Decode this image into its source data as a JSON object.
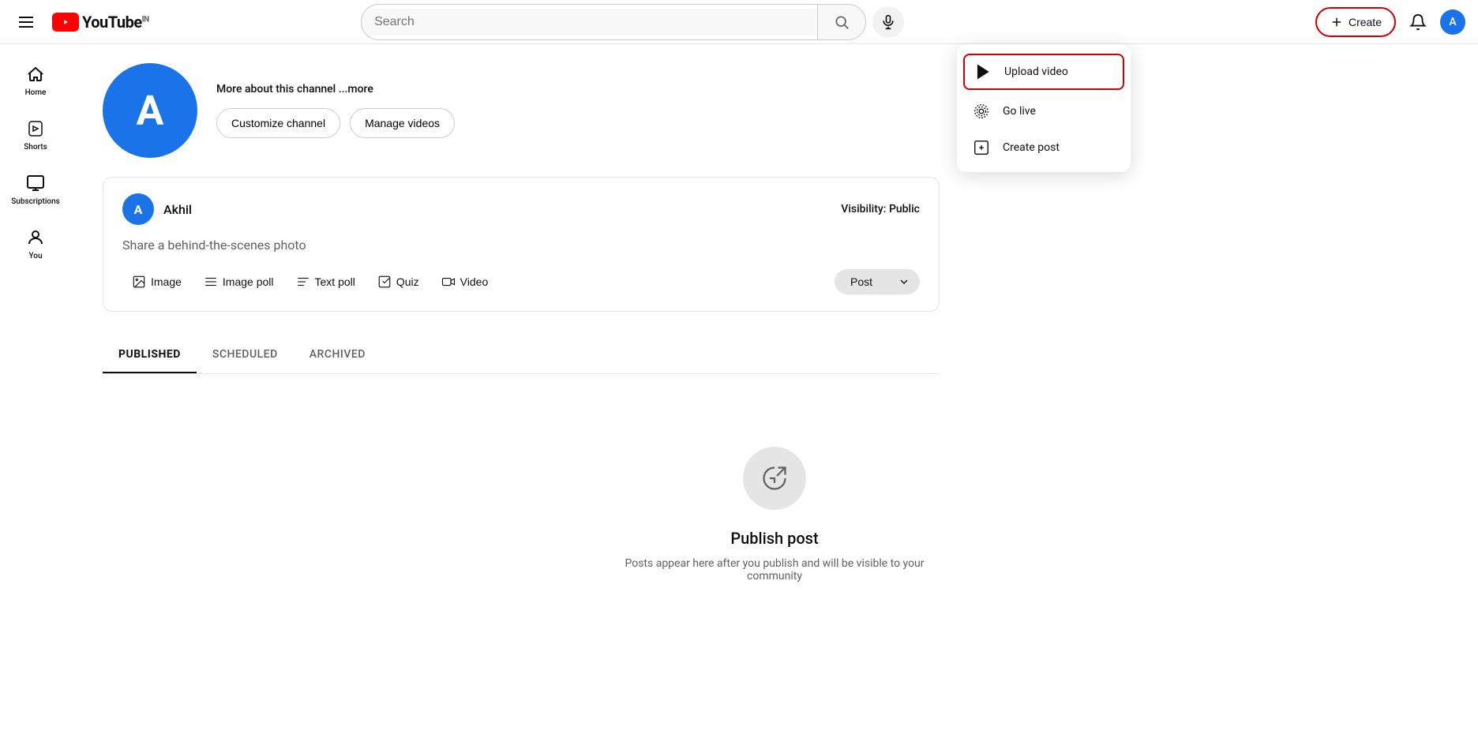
{
  "app": {
    "name": "YouTube",
    "country": "IN"
  },
  "header": {
    "search_placeholder": "Search",
    "create_label": "Create",
    "hamburger_label": "Menu"
  },
  "sidebar": {
    "items": [
      {
        "id": "home",
        "label": "Home"
      },
      {
        "id": "shorts",
        "label": "Shorts"
      },
      {
        "id": "subscriptions",
        "label": "Subscriptions"
      },
      {
        "id": "you",
        "label": "You"
      }
    ]
  },
  "channel": {
    "avatar_letter": "A",
    "more_text": "More about this channel ",
    "more_link": "...more",
    "customize_btn": "Customize channel",
    "manage_btn": "Manage videos"
  },
  "composer": {
    "avatar_letter": "A",
    "author": "Akhil",
    "visibility_label": "Visibility:",
    "visibility_value": "Public",
    "placeholder": "Share a behind-the-scenes photo",
    "toolbar": [
      {
        "id": "image",
        "label": "Image"
      },
      {
        "id": "image-poll",
        "label": "Image poll"
      },
      {
        "id": "text-poll",
        "label": "Text poll"
      },
      {
        "id": "quiz",
        "label": "Quiz"
      },
      {
        "id": "video",
        "label": "Video"
      }
    ],
    "post_btn": "Post"
  },
  "tabs": [
    {
      "id": "published",
      "label": "PUBLISHED",
      "active": true
    },
    {
      "id": "scheduled",
      "label": "SCHEDULED",
      "active": false
    },
    {
      "id": "archived",
      "label": "ARCHIVED",
      "active": false
    }
  ],
  "empty_state": {
    "title": "Publish post",
    "subtitle": "Posts appear here after you publish and will be visible to your community"
  },
  "dropdown": {
    "items": [
      {
        "id": "upload-video",
        "label": "Upload video",
        "highlighted": true
      },
      {
        "id": "go-live",
        "label": "Go live"
      },
      {
        "id": "create-post",
        "label": "Create post"
      }
    ]
  }
}
